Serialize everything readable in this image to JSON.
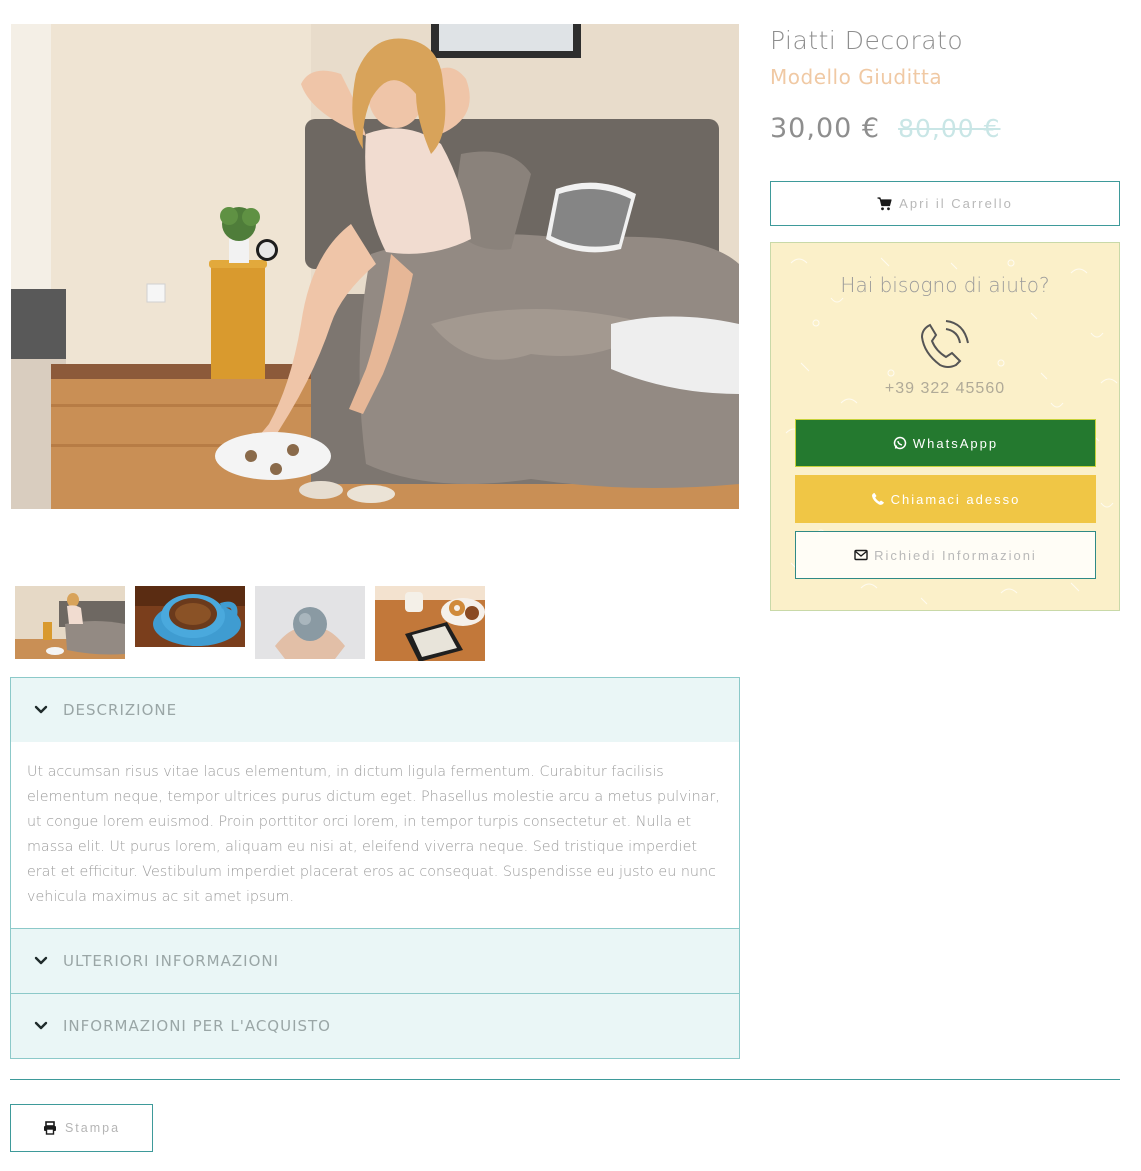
{
  "product": {
    "title": "Piatti Decorato",
    "subtitle": "Modello Giuditta",
    "price_current": "30,00 €",
    "price_old": "80,00 €"
  },
  "cart": {
    "label": "Apri il Carrello",
    "icon": "shopping-cart-icon"
  },
  "help": {
    "title": "Hai bisogno di aiuto?",
    "phone": "+39 322 45560",
    "buttons": {
      "whatsapp": "WhatsAppp",
      "call": "Chiamaci adesso",
      "info": "Richiedi Informazioni"
    },
    "colors": {
      "background": "#fbf0c9",
      "whatsapp": "#24792f",
      "call": "#f0c645"
    }
  },
  "gallery": {
    "main_image": "woman-stretching-on-bed-photo",
    "thumbnails": [
      "bedroom-thumbnail",
      "coffee-cup-thumbnail",
      "hands-holding-ball-thumbnail",
      "ereader-donuts-thumbnail"
    ]
  },
  "accordion": {
    "sections": [
      {
        "title": "DESCRIZIONE",
        "expanded": true,
        "body": "Ut accumsan risus vitae lacus elementum, in dictum ligula fermentum. Curabitur facilisis elementum neque, tempor ultrices purus dictum eget. Phasellus molestie arcu a metus pulvinar, ut congue lorem euismod. Proin porttitor orci lorem, in tempor turpis consectetur et. Nulla et massa elit. Ut purus lorem, aliquam eu nisi at, eleifend viverra neque. Sed tristique imperdiet erat et efficitur. Vestibulum imperdiet placerat eros ac consequat. Suspendisse eu justo eu nunc vehicula maximus ac sit amet ipsum."
      },
      {
        "title": "ULTERIORI INFORMAZIONI",
        "expanded": false
      },
      {
        "title": "INFORMAZIONI PER L'ACQUISTO",
        "expanded": false
      }
    ]
  },
  "print": {
    "label": "Stampa",
    "icon": "printer-icon"
  },
  "accent_color": "#3e9a9a"
}
